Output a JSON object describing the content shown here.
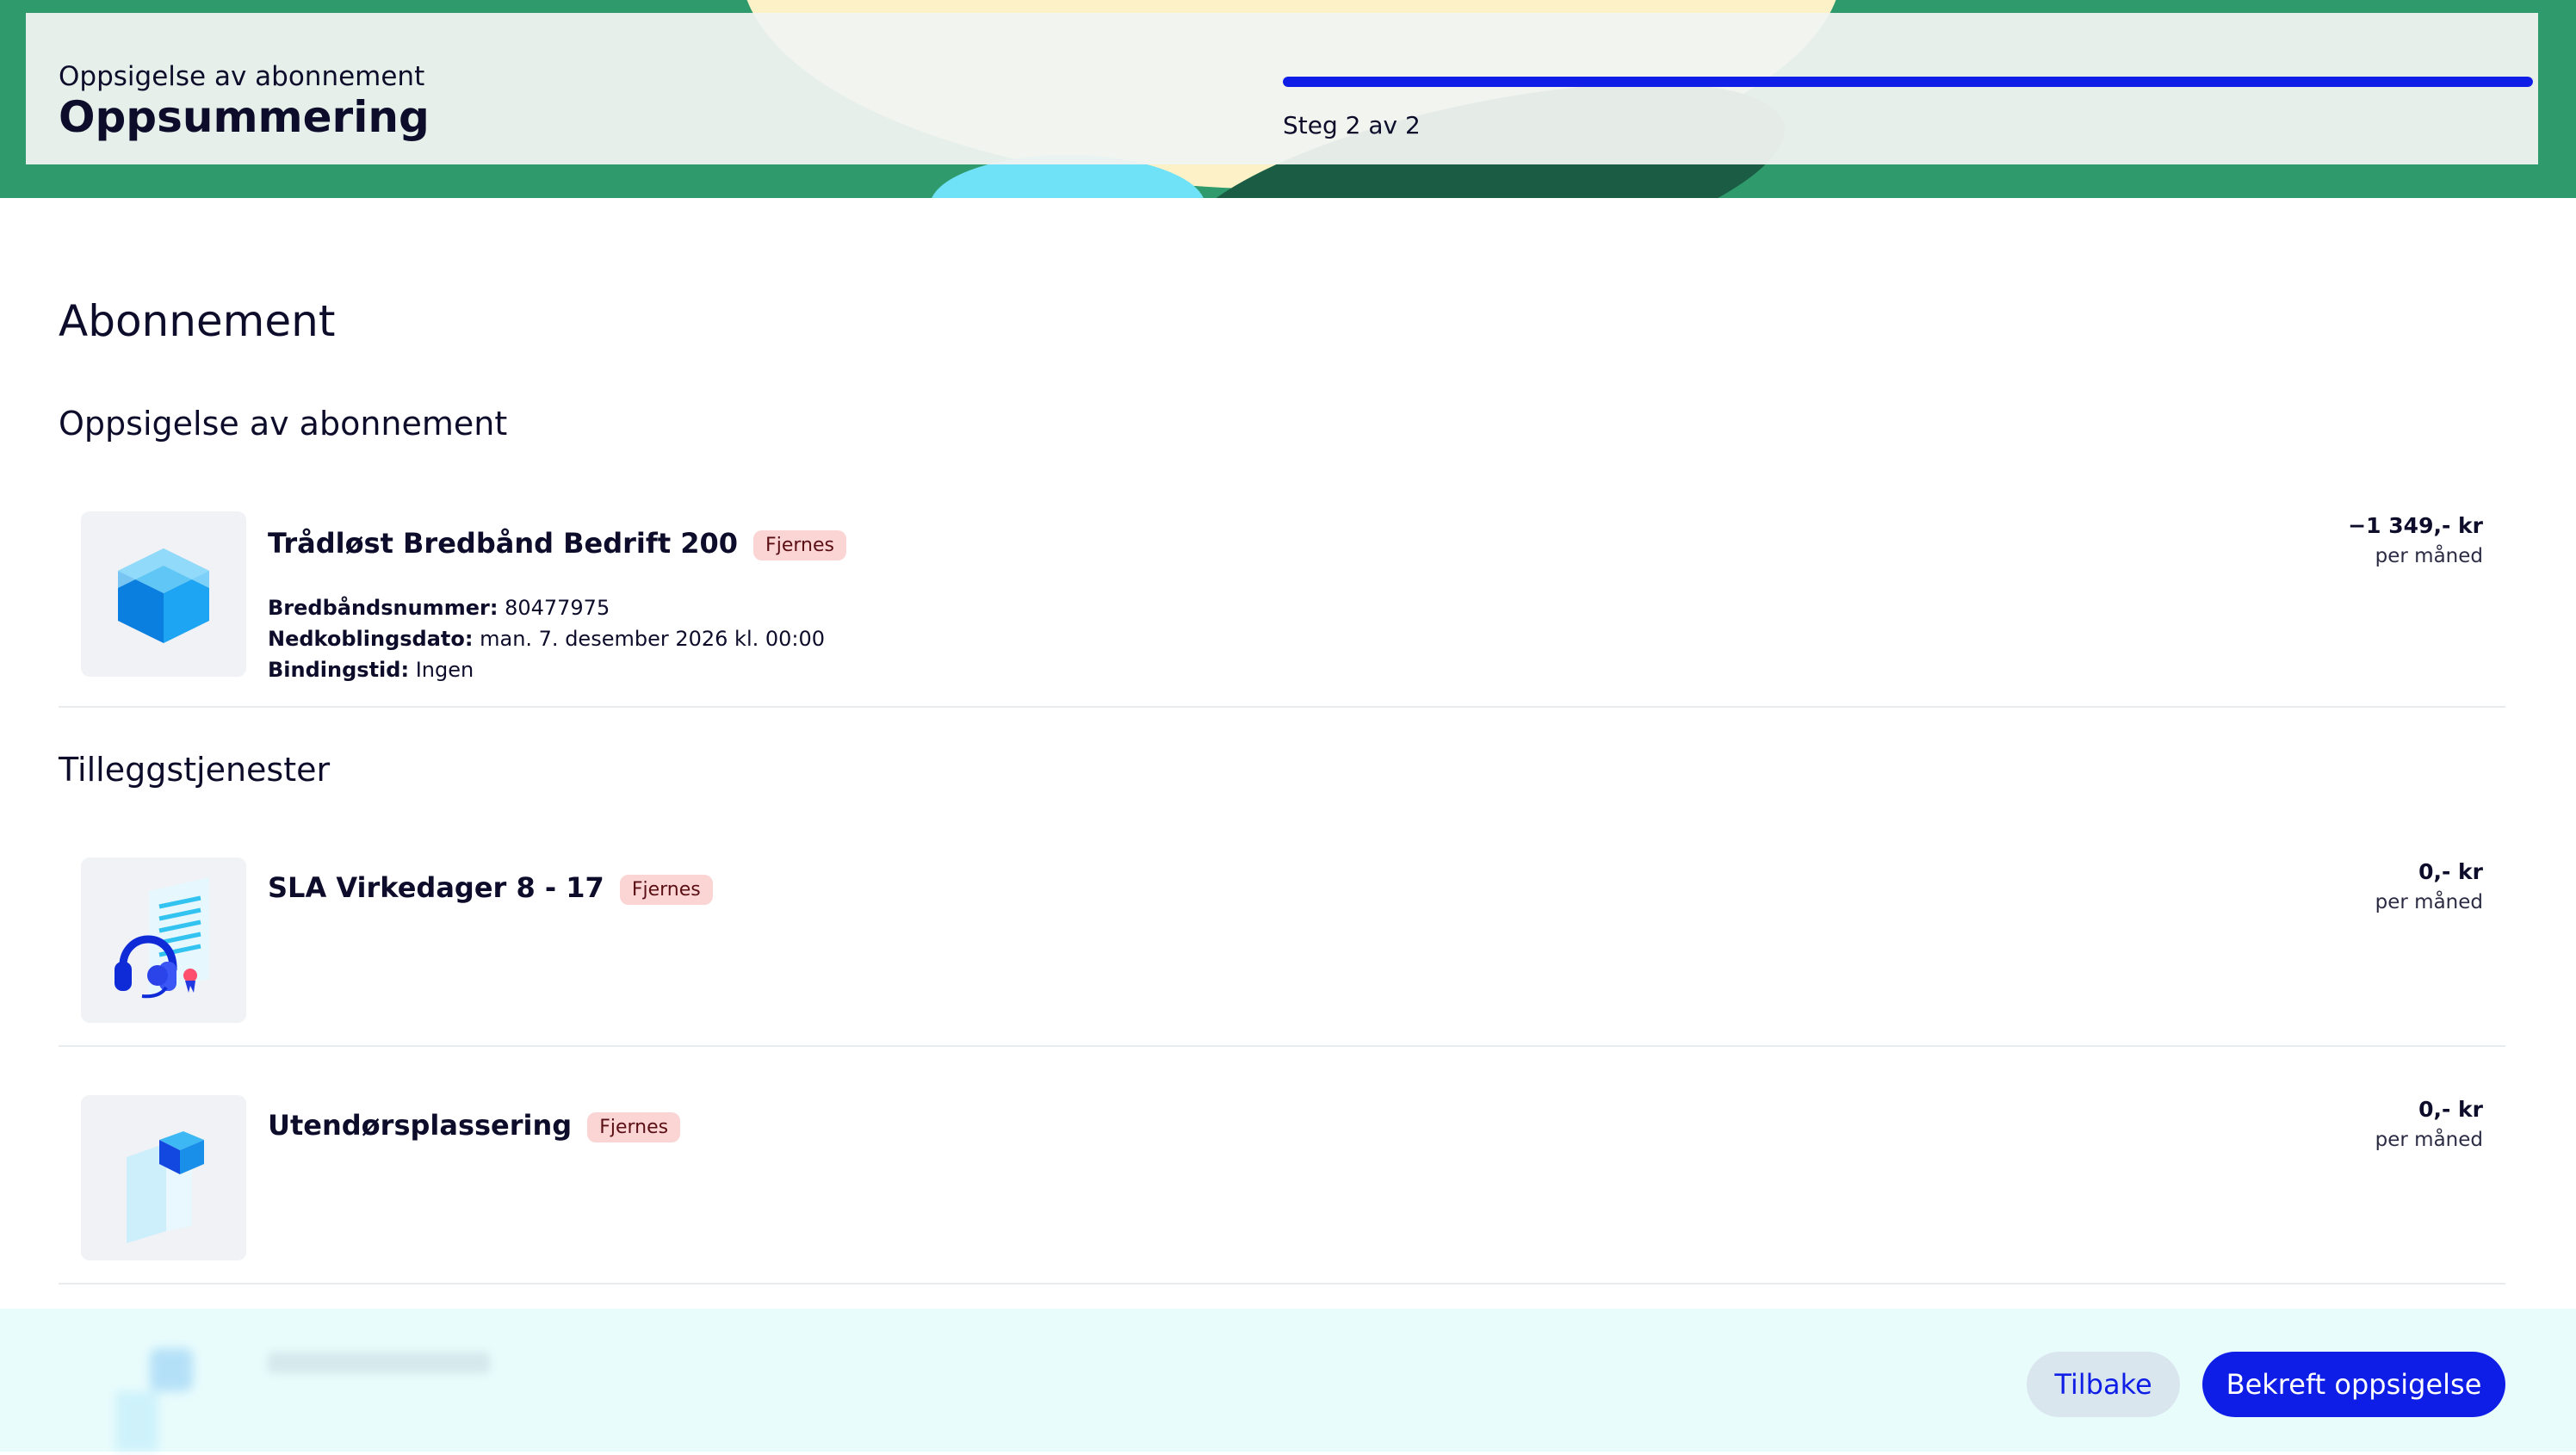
{
  "header": {
    "kicker": "Oppsigelse av abonnement",
    "title": "Oppsummering",
    "progress_label": "Steg 2 av 2",
    "progress_fraction": 1.0
  },
  "section_title": "Abonnement",
  "subscription_group": {
    "title": "Oppsigelse av abonnement",
    "item": {
      "name": "Trådløst Bredbånd Bedrift 200",
      "badge": "Fjernes",
      "icon": "cube-icon",
      "details": [
        {
          "label": "Bredbåndsnummer:",
          "value": "80477975"
        },
        {
          "label": "Nedkoblingsdato:",
          "value": "man. 7. desember 2026 kl. 00:00"
        },
        {
          "label": "Bindingstid:",
          "value": "Ingen"
        }
      ],
      "price": "−1 349,- kr",
      "period": "per måned"
    }
  },
  "addons_group": {
    "title": "Tilleggstjenester",
    "items": [
      {
        "name": "SLA Virkedager 8 - 17",
        "badge": "Fjernes",
        "icon": "headset-certificate-icon",
        "price": "0,- kr",
        "period": "per måned"
      },
      {
        "name": "Utendørsplassering",
        "badge": "Fjernes",
        "icon": "outdoor-blocks-icon",
        "price": "0,- kr",
        "period": "per måned"
      }
    ]
  },
  "actions": {
    "back_label": "Tilbake",
    "confirm_label": "Bekreft oppsigelse"
  },
  "colors": {
    "brand_blue": "#0f1ee6",
    "hero_green": "#2f9a6c",
    "badge_bg": "#fbd4d4",
    "bottom_bar": "#e9fcfc"
  }
}
